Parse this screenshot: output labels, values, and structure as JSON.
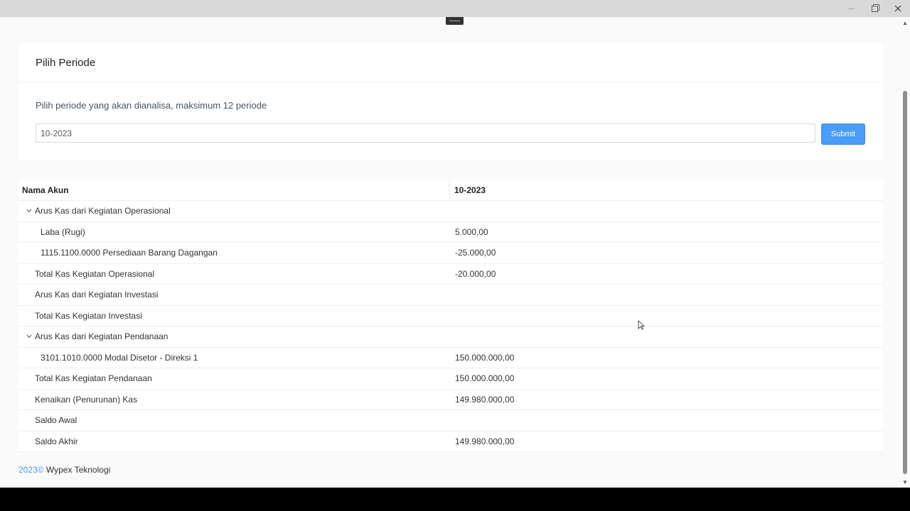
{
  "window": {
    "minimize_icon": "minimize-icon",
    "maximize_icon": "maximize-icon",
    "close_icon": "close-icon"
  },
  "period_card": {
    "title": "Pilih Periode",
    "description": "Pilih periode yang akan dianalisa, maksimum 12 periode",
    "period_value": "10-2023",
    "submit_label": "Submit"
  },
  "table": {
    "headers": {
      "name": "Nama Akun",
      "period": "10-2023"
    },
    "rows": [
      {
        "name": "Arus Kas dari Kegiatan Operasional",
        "value": ""
      },
      {
        "name": "Laba (Rugi)",
        "value": "5.000,00"
      },
      {
        "name": "1115.1100.0000 Persediaan Barang Dagangan",
        "value": "-25.000,00"
      },
      {
        "name": "Total Kas Kegiatan Operasional",
        "value": "-20.000,00"
      },
      {
        "name": "Arus Kas dari Kegiatan Investasi",
        "value": ""
      },
      {
        "name": "Total Kas Kegiatan Investasi",
        "value": ""
      },
      {
        "name": "Arus Kas dari Kegiatan Pendanaan",
        "value": ""
      },
      {
        "name": "3101.1010.0000 Modal Disetor - Direksi 1",
        "value": "150.000.000,00"
      },
      {
        "name": "Total Kas Kegiatan Pendanaan",
        "value": "150.000.000,00"
      },
      {
        "name": "Kenaikan (Penurunan) Kas",
        "value": "149.980.000,00"
      },
      {
        "name": "Saldo Awal",
        "value": ""
      },
      {
        "name": "Saldo Akhir",
        "value": "149.980.000,00"
      }
    ]
  },
  "footer": {
    "year": "2023©",
    "company": "Wypex Teknologi"
  },
  "colors": {
    "accent": "#4a9cf5",
    "background": "#fafafa"
  }
}
